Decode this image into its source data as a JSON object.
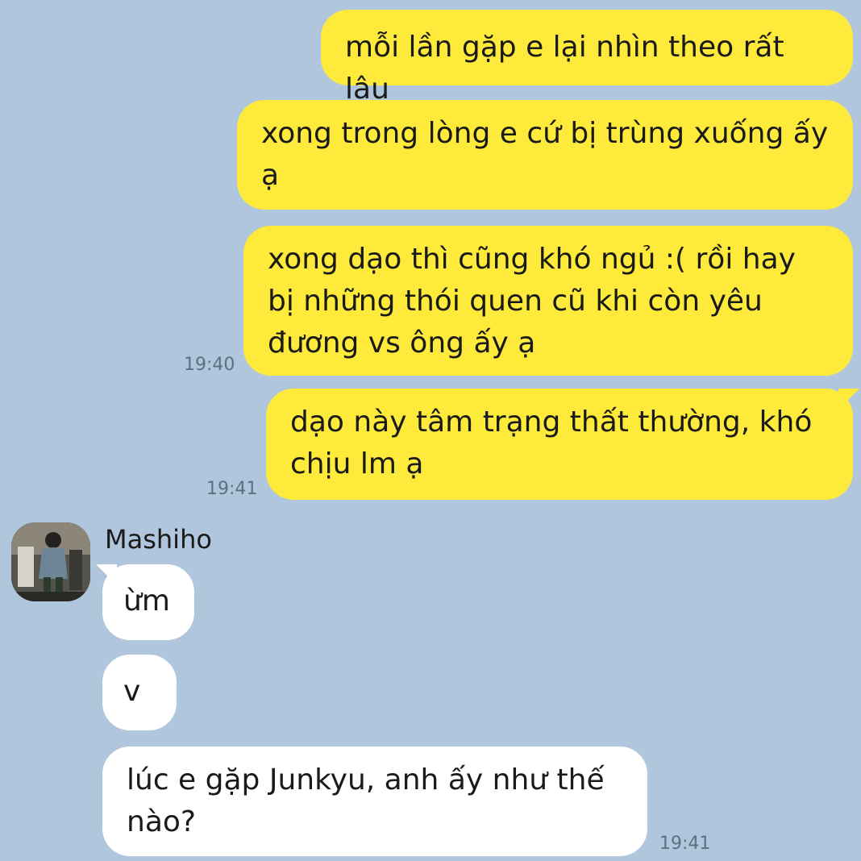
{
  "messages_out": [
    {
      "text": "mỗi lần gặp e lại nhìn theo rất lâu"
    },
    {
      "text": "xong trong lòng e cứ bị trùng xuống ấy ạ"
    },
    {
      "text": "xong dạo thì cũng khó ngủ :( rồi hay bị những thói quen cũ khi còn yêu đương vs ông ấy ạ",
      "time": "19:40"
    },
    {
      "text": "dạo này tâm trạng thất thường, khó chịu lm ạ",
      "time": "19:41"
    }
  ],
  "contact": {
    "name": "Mashiho",
    "avatar_icon": "profile-photo"
  },
  "messages_in": [
    {
      "text": "ừm"
    },
    {
      "text": "v"
    },
    {
      "text": "lúc e gặp Junkyu, anh ấy như thế nào?",
      "time": "19:41"
    }
  ],
  "colors": {
    "background": "#b0c6dc",
    "outgoing_bubble": "#fdea3a",
    "incoming_bubble": "#ffffff",
    "timestamp": "#5d6f80"
  }
}
